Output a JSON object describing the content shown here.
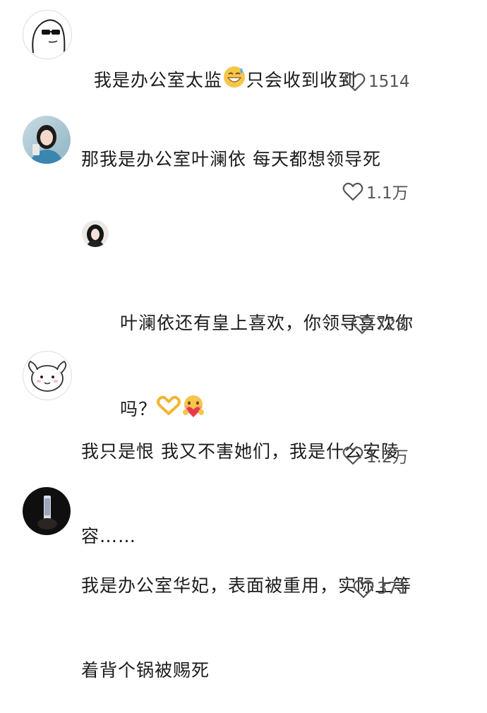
{
  "comments": [
    {
      "text_a": "我是办公室太监",
      "emoji": "grin-sweat-emoji",
      "text_b": "只会收到收到",
      "likes": "1514",
      "avatar": "sunglasses-cartoon-avatar"
    },
    {
      "text": "那我是办公室叶澜依 每天都想领导死",
      "likes": "1.1万",
      "avatar": "woman-photo-avatar"
    },
    {
      "text_line1": "叶澜依还有皇上喜欢，你领导喜欢你",
      "text_line2": "吗？",
      "emojis": [
        "heart-hands-emoji",
        "hugging-heart-emoji"
      ],
      "likes": "728",
      "avatar": "dark-hair-girl-avatar"
    },
    {
      "text_line1": "我只是恨 我又不害她们，我是什么安陵",
      "text_line2": "容……",
      "likes": "1.2万",
      "avatar": "bunny-cartoon-avatar"
    },
    {
      "text_line1": "我是办公室华妃，表面被重用，实际上等",
      "text_line2": "着背个锅被赐死",
      "likes": "371",
      "avatar": "dark-photo-avatar"
    }
  ],
  "colors": {
    "text": "#1b1b1b",
    "like_text": "#555555",
    "emoji_yellow": "#f6c64a",
    "heart_red": "#e8394a"
  }
}
